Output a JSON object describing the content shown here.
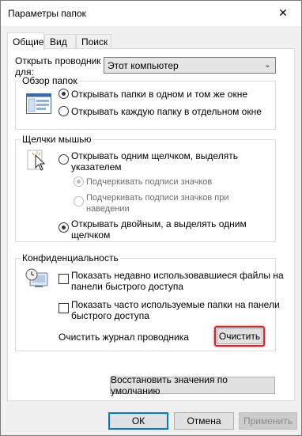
{
  "window": {
    "title": "Параметры папок",
    "close_glyph": "✕"
  },
  "tabs": [
    {
      "label": "Общие",
      "active": true
    },
    {
      "label": "Вид",
      "active": false
    },
    {
      "label": "Поиск",
      "active": false
    }
  ],
  "open_explorer": {
    "label_line1": "Открыть проводник",
    "label_line2": "для:",
    "selected": "Этот компьютер"
  },
  "browse_folders": {
    "title": "Обзор папок",
    "options": [
      {
        "label": "Открывать папки в одном и том же окне",
        "checked": true
      },
      {
        "label": "Открывать каждую папку в отдельном окне",
        "checked": false
      }
    ]
  },
  "clicks": {
    "title": "Щелчки мышью",
    "single_click_line1": "Открывать одним щелчком, выделять",
    "single_click_line2": "указателем",
    "underline_always": "Подчеркивать подписи значков",
    "underline_hover_line1": "Подчеркивать подписи значков при",
    "underline_hover_line2": "наведении",
    "double_click_line1": "Открывать двойным, а выделять одним",
    "double_click_line2": "щелчком"
  },
  "privacy": {
    "title": "Конфиденциальность",
    "recent_files_line1": "Показать недавно использовавшиеся файлы на",
    "recent_files_line2": "панели быстрого доступа",
    "frequent_folders_line1": "Показать часто используемые папки на панели",
    "frequent_folders_line2": "быстрого доступа",
    "clear_history_label": "Очистить журнал проводника",
    "clear_button": "Очистить"
  },
  "restore_defaults_button": "Восстановить значения по умолчанию",
  "footer": {
    "ok": "ОК",
    "cancel": "Отмена",
    "apply": "Применить"
  },
  "colors": {
    "highlight": "#d0272b",
    "accent": "#0078d7"
  }
}
